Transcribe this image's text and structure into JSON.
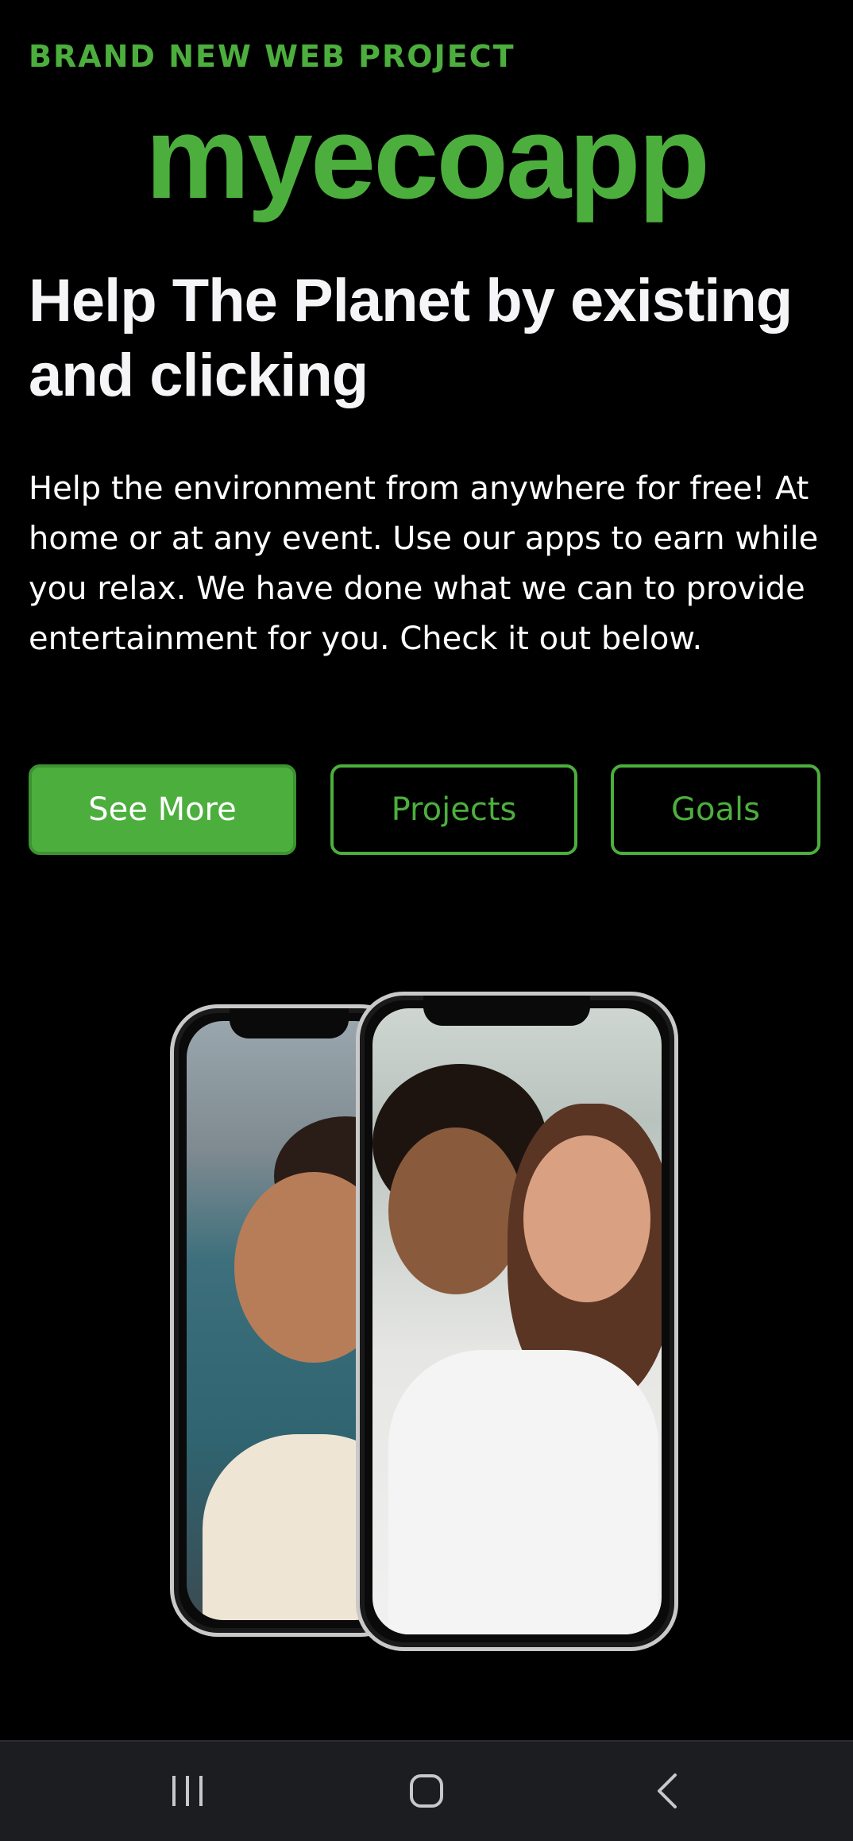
{
  "hero": {
    "eyebrow": "BRAND NEW WEB PROJECT",
    "brand": "myecoapp",
    "headline": "Help The Planet by existing and clicking",
    "description": "Help the environment from anywhere for free! At home or at any event. Use our apps to earn while you relax. We have done what we can to provide entertainment for you. Check it out below."
  },
  "buttons": {
    "primary_label": "See More",
    "projects_label": "Projects",
    "goals_label": "Goals"
  },
  "illustration": {
    "icon": "two-phones-illustration"
  },
  "navbar": {
    "recent_icon": "recent-apps-icon",
    "home_icon": "home-icon",
    "back_icon": "back-icon"
  },
  "colors": {
    "accent": "#4caf3d",
    "background": "#000000",
    "navbar": "#1c1d21"
  }
}
